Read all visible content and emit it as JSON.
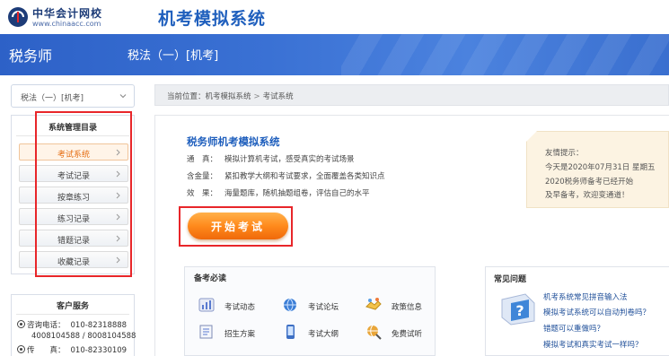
{
  "header": {
    "logo_name": "中华会计网校",
    "logo_url": "www.chinaacc.com",
    "system_title": "机考模拟系统"
  },
  "banner": {
    "role": "税务师",
    "subject": "税法（一）[机考]"
  },
  "sidebar": {
    "subject_select": "税法（一）[机考]",
    "menu_title": "系统管理目录",
    "menu_items": [
      {
        "label": "考试系统",
        "active": true
      },
      {
        "label": "考试记录",
        "active": false
      },
      {
        "label": "按章练习",
        "active": false
      },
      {
        "label": "练习记录",
        "active": false
      },
      {
        "label": "错题记录",
        "active": false
      },
      {
        "label": "收藏记录",
        "active": false
      }
    ],
    "service": {
      "title": "客户服务",
      "phone_label": "咨询电话：",
      "phone_1": "010-82318888",
      "phone_2": "4008104588 / 8008104588",
      "fax_label": "传　　真：",
      "fax": "010-82330109"
    }
  },
  "breadcrumb": {
    "prefix": "当前位置：",
    "items": [
      "机考模拟系统",
      "考试系统"
    ]
  },
  "intro": {
    "title": "税务师机考模拟系统",
    "rows": [
      {
        "key": "通　真：",
        "text": "模拟计算机考试，感受真实的考试场景"
      },
      {
        "key": "含金量：",
        "text": "紧扣教学大纲和考试要求，全面覆盖各类知识点"
      },
      {
        "key": "效　果：",
        "text": "海量题库，随机抽题组卷，评估自己的水平"
      }
    ],
    "start_button": "开始考试"
  },
  "notice": {
    "lines": [
      "友情提示：",
      "今天是2020年07月31日 星期五",
      "2020税务师备考已经开始",
      "及早备考，欢迎变通道！"
    ]
  },
  "prep": {
    "title": "备考必读",
    "items": [
      {
        "label": "考试动态",
        "icon": "chart-icon"
      },
      {
        "label": "考试论坛",
        "icon": "globe-icon"
      },
      {
        "label": "政策信息",
        "icon": "handshake-icon"
      },
      {
        "label": "招生方案",
        "icon": "document-icon"
      },
      {
        "label": "考试大纲",
        "icon": "phone-icon"
      },
      {
        "label": "免费试听",
        "icon": "globe-search-icon"
      }
    ]
  },
  "faq": {
    "title": "常见问题",
    "items": [
      "机考系统常见拼音输入法",
      "模拟考试系统可以自动判卷吗？",
      "错题可以重做吗？",
      "模拟考试和真实考试一样吗？"
    ]
  },
  "colors": {
    "brand_blue": "#1f5fbd",
    "banner_blue": "#3a71d4",
    "accent_orange": "#ff8a1c",
    "highlight_red": "#e8262a"
  }
}
